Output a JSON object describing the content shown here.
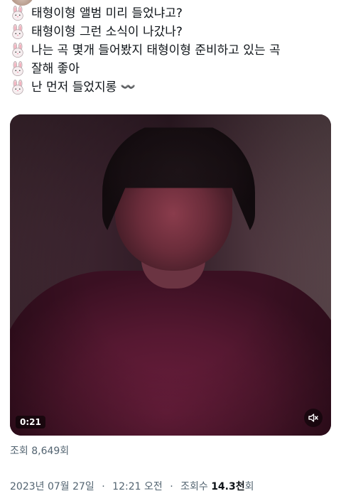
{
  "tweet": {
    "lines": [
      "태형이형 앨범 미리 들었냐고?",
      "태형이형 그런 소식이 나갔나?",
      "나는 곡 몇개 들어봤지 태형이형 준비하고 있는 곡",
      "잘해 좋아",
      "난 먼저 들었지롱 〰️"
    ],
    "emoji_icon": "rabbit-face-icon"
  },
  "video": {
    "duration": "0:21",
    "mute_icon": "speaker-muted-icon"
  },
  "views_text": "조회 8,649회",
  "meta": {
    "date": "2023년 07월 27일",
    "time": "12:21 오전",
    "views_label": "조회수",
    "views_value": "14.3천",
    "views_unit": "회"
  }
}
